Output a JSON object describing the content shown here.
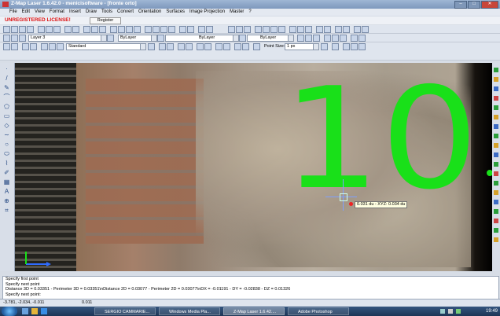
{
  "window": {
    "title": "Z-Map Laser 1.6.42.0 - menicisoftware - [fronte orto]"
  },
  "menu": [
    "File",
    "Edit",
    "View",
    "Format",
    "Insert",
    "Draw",
    "Tools",
    "Convert",
    "Orientation",
    "Surfaces",
    "Image Projection",
    "Master",
    "?"
  ],
  "license": {
    "warning": "UNREGISTERED LICENSE!",
    "register_label": "Register"
  },
  "toolbar": {
    "layer": "Layer 3",
    "color": "ByLayer",
    "linetype": "ByLayer",
    "lineweight": "ByLayer",
    "style": "Standard",
    "point_size_label": "Point Size:",
    "point_size": "1 px"
  },
  "viewport": {
    "overlay_number": "10",
    "tooltip": "0.031 du - XYZ: 0.034 du"
  },
  "command_history": [
    "Specify first point",
    "Specify next point",
    "Distance 3D = 0.03351 - Perimeter 3D = 0.03351\\nDistance 2D = 0.03077 - Perimeter 2D = 0.03077\\nDX = -0.01191 - DY = -0.02838 - DZ = 0.01326",
    "Specify next point:"
  ],
  "status": {
    "coords": "-3.781, -2.034, -0.011",
    "value": "0.011"
  },
  "taskbar": {
    "items": [
      "SERGIO CAMMARIE...",
      "Windows Media Pla...",
      "Z-Map Laser 1.6.42....",
      "Adobe Photoshop"
    ],
    "clock": "19:49"
  },
  "colors": {
    "accent_green": "#19e019",
    "warning_red": "#dd1111",
    "taskbar": "#1d3556"
  }
}
